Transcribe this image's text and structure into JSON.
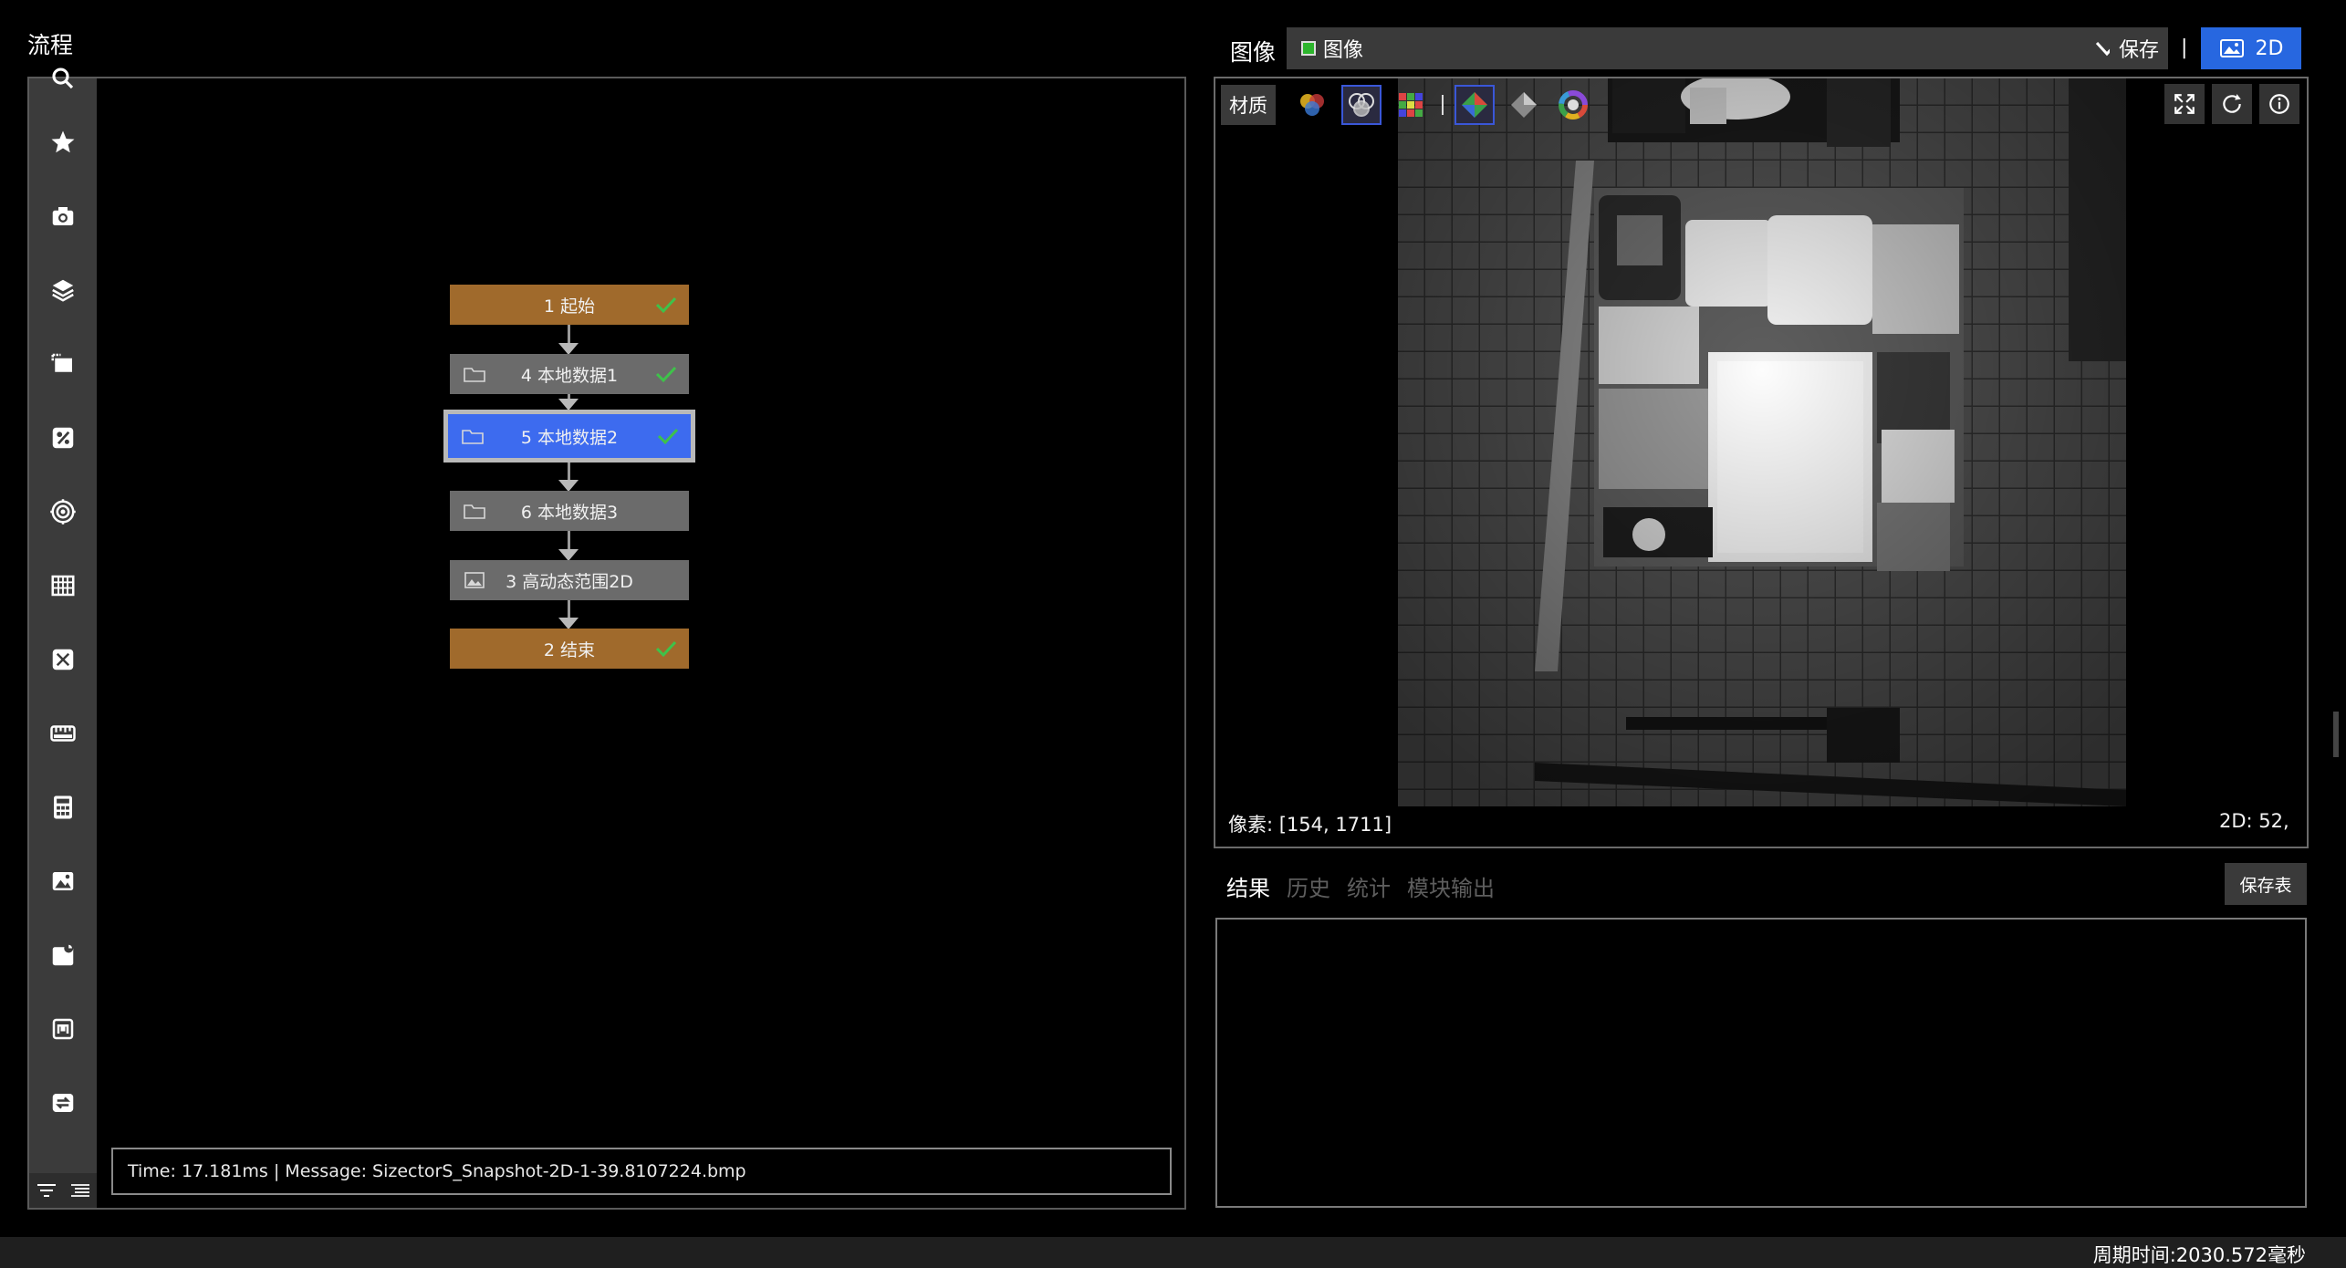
{
  "flow": {
    "title": "流程",
    "nodes": [
      {
        "label": "1 起始",
        "style": "start",
        "checked": true,
        "icon": "none"
      },
      {
        "label": "4 本地数据1",
        "style": "gray",
        "checked": true,
        "icon": "folder-icon"
      },
      {
        "label": "5 本地数据2",
        "style": "active",
        "checked": true,
        "icon": "folder-icon"
      },
      {
        "label": "6 本地数据3",
        "style": "gray",
        "checked": false,
        "icon": "folder-icon"
      },
      {
        "label": "3 高动态范围2D",
        "style": "gray",
        "checked": false,
        "icon": "image-icon"
      },
      {
        "label": "2 结束",
        "style": "start",
        "checked": true,
        "icon": "none"
      }
    ],
    "status_text": "Time: 17.181ms  |   Message: SizectorS_Snapshot-2D-1-39.8107224.bmp"
  },
  "toolbar_icons": [
    "search-icon",
    "star-icon",
    "camera-icon",
    "layers-icon",
    "clip-icon",
    "tag-icon",
    "target-icon",
    "grid-icon",
    "measure-icon",
    "ruler-icon",
    "calculator-icon",
    "picture-icon",
    "chart-icon",
    "robot-icon",
    "exchange-icon"
  ],
  "viewer": {
    "title": "图像",
    "source": "图像",
    "save_label": "保存",
    "separator": "|",
    "mode_label": "2D",
    "material_label": "材质",
    "pixel_readout": "像素: [154, 1711]",
    "value_readout": "2D: 52,"
  },
  "results": {
    "tabs": [
      {
        "label": "结果",
        "active": true
      },
      {
        "label": "历史",
        "active": false
      },
      {
        "label": "统计",
        "active": false
      },
      {
        "label": "模块输出",
        "active": false
      }
    ],
    "save_table_label": "保存表"
  },
  "footer": {
    "cycle_time": "周期时间:2030.572毫秒"
  },
  "colors": {
    "start_node": "#a06a2c",
    "active_node": "#3d6bef",
    "gray_node": "#6b6b6b",
    "check": "#3ec24a",
    "accent": "#2767e0"
  }
}
